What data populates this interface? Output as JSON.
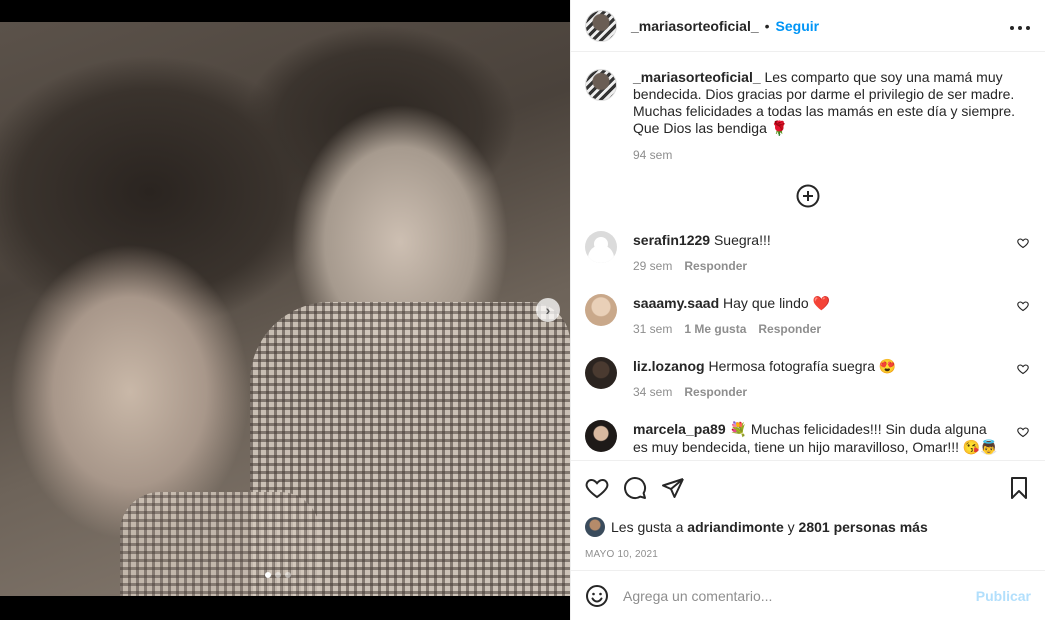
{
  "post": {
    "author": "_mariasorteoficial_",
    "follow_label": "Seguir",
    "separator": "•",
    "more_label": "•••",
    "caption": "Les comparto que soy una mamá muy bendecida. Dios gracias por darme el privilegio de ser madre. Muchas felicidades a todas las mamás en este día y siempre. Que Dios las bendiga 🌹",
    "caption_time": "94 sem",
    "load_more_icon": "plus-circle-icon"
  },
  "comments": [
    {
      "user": "serafin1229",
      "text": "Suegra!!!",
      "time": "29 sem",
      "likes": "",
      "reply": "Responder"
    },
    {
      "user": "saaamy.saad",
      "text": "Hay que lindo ❤️",
      "time": "31 sem",
      "likes": "1 Me gusta",
      "reply": "Responder"
    },
    {
      "user": "liz.lozanog",
      "text": "Hermosa fotografía suegra 😍",
      "time": "34 sem",
      "likes": "",
      "reply": "Responder"
    },
    {
      "user": "marcela_pa89",
      "text": "💐 Muchas felicidades!!! Sin duda alguna es muy bendecida, tiene un hijo maravilloso, Omar!!! 😘👼🖤💙",
      "time": "",
      "likes": "",
      "reply": ""
    }
  ],
  "likes": {
    "prefix": "Les gusta a",
    "user": "adriandimonte",
    "conj": "y",
    "count": "2801 personas más"
  },
  "date": "MAYO 10, 2021",
  "add_comment": {
    "placeholder": "Agrega un comentario...",
    "post_label": "Publicar"
  },
  "colors": {
    "link": "#0095f6",
    "muted": "#8e8e8e",
    "post_disabled": "#b2dffc"
  }
}
